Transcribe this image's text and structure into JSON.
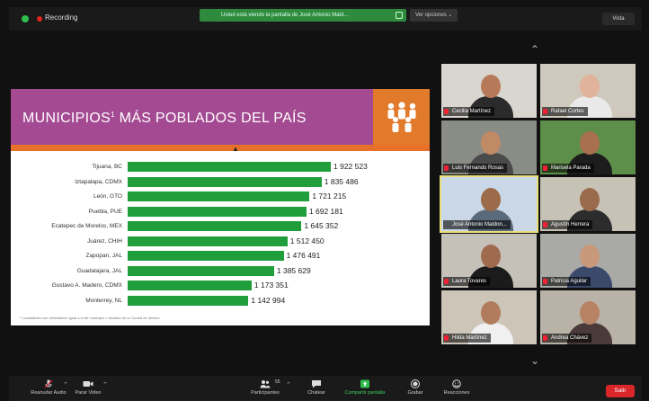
{
  "topbar": {
    "recording_label": "Recording",
    "share_label": "Usted está viendo la pantalla de José Antonio Mald...",
    "view_options_label": "Ver opciones ⌄",
    "view_button_label": "Vista"
  },
  "slide": {
    "title": "MUNICIPIOS",
    "title_super": "1",
    "title_rest": " MÁS POBLADOS DEL PAÍS",
    "footnote": "¹ Localidades con delimitación igual a la de municipio o alcaldía de la Ciudad de México."
  },
  "chart_data": {
    "type": "bar",
    "orientation": "horizontal",
    "title": "MUNICIPIOS¹ MÁS POBLADOS DEL PAÍS",
    "categories": [
      "Tijuana, BC",
      "Iztapalapa, CDMX",
      "León, GTO",
      "Puebla, PUE",
      "Ecatepec de Morelos, MEX",
      "Juárez, CHIH",
      "Zapopan, JAL",
      "Guadalajara, JAL",
      "Gustavo A. Madero, CDMX",
      "Monterrey, NL"
    ],
    "values": [
      1922523,
      1835486,
      1721215,
      1692181,
      1645352,
      1512450,
      1476491,
      1385629,
      1173351,
      1142994
    ],
    "value_labels": [
      "1 922 523",
      "1 835 486",
      "1 721 215",
      "1 692 181",
      "1 645 352",
      "1 512 450",
      "1 476 491",
      "1 385 629",
      "1 173 351",
      "1 142 994"
    ],
    "bar_color": "#1f9e3b",
    "xlim": [
      0,
      1922523
    ]
  },
  "participants": [
    {
      "name": "Cecilia Martínez",
      "muted": true
    },
    {
      "name": "Rafael Cortes",
      "muted": true
    },
    {
      "name": "Luis Fernando Rosas",
      "muted": true
    },
    {
      "name": "Marisela Parada",
      "muted": true
    },
    {
      "name": "José Antonio Maldon...",
      "muted": false,
      "active": true
    },
    {
      "name": "Agustín Herrera",
      "muted": true
    },
    {
      "name": "Laura Tovares",
      "muted": true
    },
    {
      "name": "Patricia Aguilar",
      "muted": true
    },
    {
      "name": "Hilda Martínez",
      "muted": true
    },
    {
      "name": "Andrea Chávez",
      "muted": true
    }
  ],
  "toolbar": {
    "audio_label": "Reanudar Audio",
    "video_label": "Parar Video",
    "participants_label": "Participantes",
    "participants_count": "55",
    "chat_label": "Chatear",
    "share_label": "Compartir pantalla",
    "record_label": "Grabar",
    "reactions_label": "Reacciones",
    "leave_label": "Salir"
  },
  "colors": {
    "header_purple": "#a44a92",
    "header_orange": "#e8712a",
    "share_green": "#2e8b3e",
    "leave_red": "#d9262b"
  }
}
